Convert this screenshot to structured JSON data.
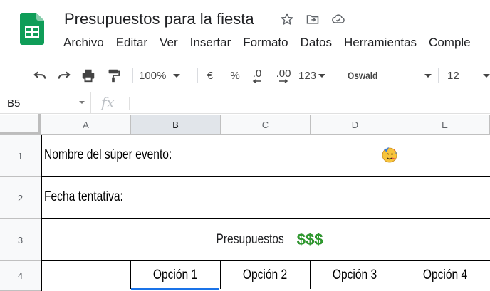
{
  "app": {
    "title": "Presupuestos para la fiesta",
    "brand_color": "#0f9d58",
    "icons": [
      "star-icon",
      "move-to-folder-icon",
      "cloud-saved-icon"
    ]
  },
  "menu": {
    "items": [
      "Archivo",
      "Editar",
      "Ver",
      "Insertar",
      "Formato",
      "Datos",
      "Herramientas",
      "Comple"
    ]
  },
  "toolbar": {
    "zoom": "100%",
    "currency": "€",
    "percent": "%",
    "decrease_decimals": ".0",
    "increase_decimals": ".00",
    "more_formats": "123",
    "font": "Oswald",
    "font_size": "12"
  },
  "formula_bar": {
    "name_box": "B5",
    "fx": "fx",
    "value": ""
  },
  "grid": {
    "columns": [
      "A",
      "B",
      "C",
      "D",
      "E"
    ],
    "selected_column": "B",
    "rows": [
      "1",
      "2",
      "3",
      "4"
    ],
    "cells": {
      "A1": "Nombre del súper evento:",
      "D1_emoji": "partying-face-emoji",
      "A2": "Fecha tentativa:",
      "A3": "Presupuestos",
      "A3_money": "$$$",
      "B4": "Opción 1",
      "C4": "Opción 2",
      "D4": "Opción 3",
      "E4": "Opción 4"
    },
    "money_color": "#2e9c2e",
    "selection_color": "#1a73e8"
  }
}
